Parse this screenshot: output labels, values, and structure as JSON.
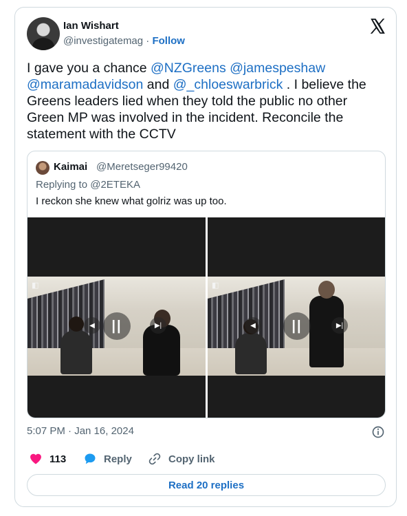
{
  "tweet": {
    "author": {
      "name": "Ian Wishart",
      "handle": "@investigatemag",
      "separator": " · ",
      "follow_label": "Follow"
    },
    "text": {
      "part1": "I gave you a chance ",
      "mention1": "@NZGreens",
      "space1": " ",
      "mention2": "@jamespeshaw",
      "space2": " ",
      "mention3": "@maramadavidson",
      "and": " and ",
      "mention4": "@_chloeswarbrick",
      "part2": " . I believe the Greens leaders lied when they told the public no other Green MP was involved in the incident. Reconcile the statement with the CCTV"
    },
    "quote": {
      "name": "Kaimai",
      "handle": "@Meretseger99420",
      "replying_to": "Replying to @2ETEKA",
      "text": "I reckon she knew what golriz was up too.",
      "video": {
        "pause_symbol": "||",
        "prev_symbol": "◀",
        "next_symbol": "▶|"
      }
    },
    "timestamp": "5:07 PM · Jan 16, 2024",
    "actions": {
      "like_count": "113",
      "reply_label": "Reply",
      "copy_label": "Copy link"
    },
    "read_replies_label": "Read 20 replies"
  },
  "icons": {
    "logo": "x-logo-icon",
    "info": "info-icon",
    "like": "heart-icon",
    "reply": "speech-bubble-icon",
    "copy": "link-icon"
  },
  "colors": {
    "link": "#1d6fc4",
    "like": "#f91880",
    "muted": "#536471",
    "border": "#cfd9de"
  }
}
